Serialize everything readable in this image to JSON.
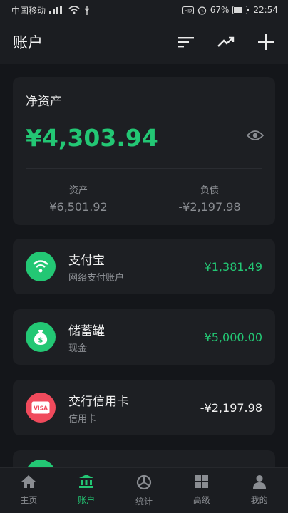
{
  "status_bar": {
    "carrier": "中国移动",
    "battery": "67%",
    "time": "22:54"
  },
  "header": {
    "title": "账户",
    "icons": [
      "sort-icon",
      "trend-icon",
      "add-icon"
    ]
  },
  "net_assets": {
    "label": "净资产",
    "value": "¥4,303.94",
    "assets_label": "资产",
    "assets_value": "¥6,501.92",
    "liabilities_label": "负债",
    "liabilities_value": "-¥2,197.98"
  },
  "accounts": [
    {
      "name": "支付宝",
      "type": "网络支付账户",
      "balance": "¥1,381.49",
      "icon": "wifi-icon",
      "color": "#23c774"
    },
    {
      "name": "储蓄罐",
      "type": "现金",
      "balance": "¥5,000.00",
      "icon": "money-bag-icon",
      "color": "#23c774"
    },
    {
      "name": "交行信用卡",
      "type": "信用卡",
      "balance": "-¥2,197.98",
      "icon": "visa-card-icon",
      "color": "#f04a5c"
    }
  ],
  "nav": [
    {
      "label": "主页",
      "icon": "home-icon",
      "active": false
    },
    {
      "label": "账户",
      "icon": "bank-icon",
      "active": true
    },
    {
      "label": "统计",
      "icon": "stats-icon",
      "active": false
    },
    {
      "label": "高级",
      "icon": "grid-icon",
      "active": false
    },
    {
      "label": "我的",
      "icon": "person-icon",
      "active": false
    }
  ],
  "colors": {
    "accent": "#23c774",
    "credit": "#f04a5c",
    "background": "#14161a",
    "card": "#1d1f23"
  }
}
